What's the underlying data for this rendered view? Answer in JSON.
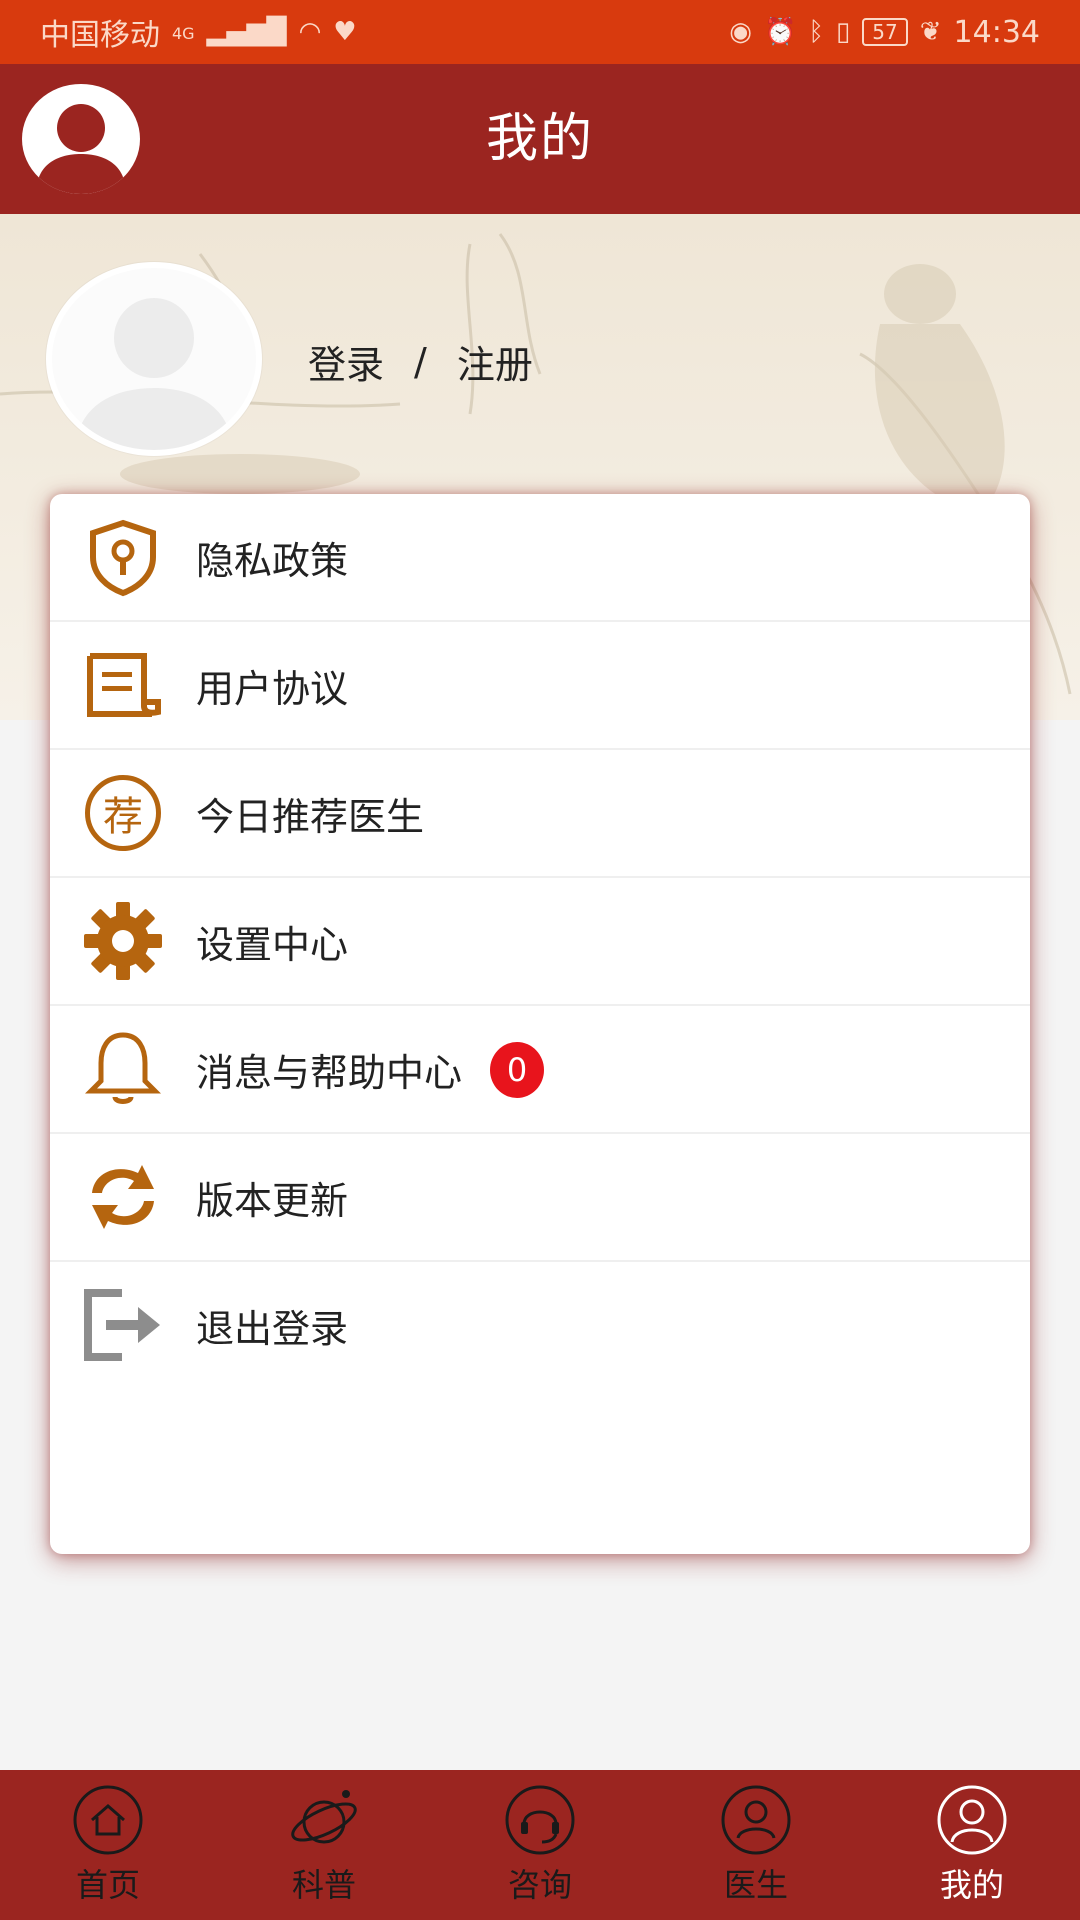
{
  "status_bar": {
    "carrier": "中国移动",
    "network": "4G",
    "battery": "57",
    "time": "14:34"
  },
  "header": {
    "title": "我的"
  },
  "profile": {
    "login": "登录",
    "separator": "/",
    "register": "注册"
  },
  "menu": {
    "items": [
      {
        "label": "隐私政策",
        "icon": "shield-lock-icon"
      },
      {
        "label": "用户协议",
        "icon": "scroll-icon"
      },
      {
        "label": "今日推荐医生",
        "icon": "recommend-icon"
      },
      {
        "label": "设置中心",
        "icon": "gear-icon"
      },
      {
        "label": "消息与帮助中心",
        "icon": "bell-icon",
        "badge": "0"
      },
      {
        "label": "版本更新",
        "icon": "refresh-icon"
      },
      {
        "label": "退出登录",
        "icon": "logout-icon"
      }
    ],
    "recommend_glyph": "荐"
  },
  "bottom_nav": {
    "items": [
      {
        "label": "首页",
        "icon": "home-icon"
      },
      {
        "label": "科普",
        "icon": "planet-icon"
      },
      {
        "label": "咨询",
        "icon": "headset-icon"
      },
      {
        "label": "医生",
        "icon": "doctor-icon"
      },
      {
        "label": "我的",
        "icon": "user-icon",
        "active": true
      }
    ]
  },
  "colors": {
    "status_bar": "#d83a0e",
    "primary": "#9b2520",
    "icon_accent": "#b5650f",
    "badge": "#e8141c"
  }
}
